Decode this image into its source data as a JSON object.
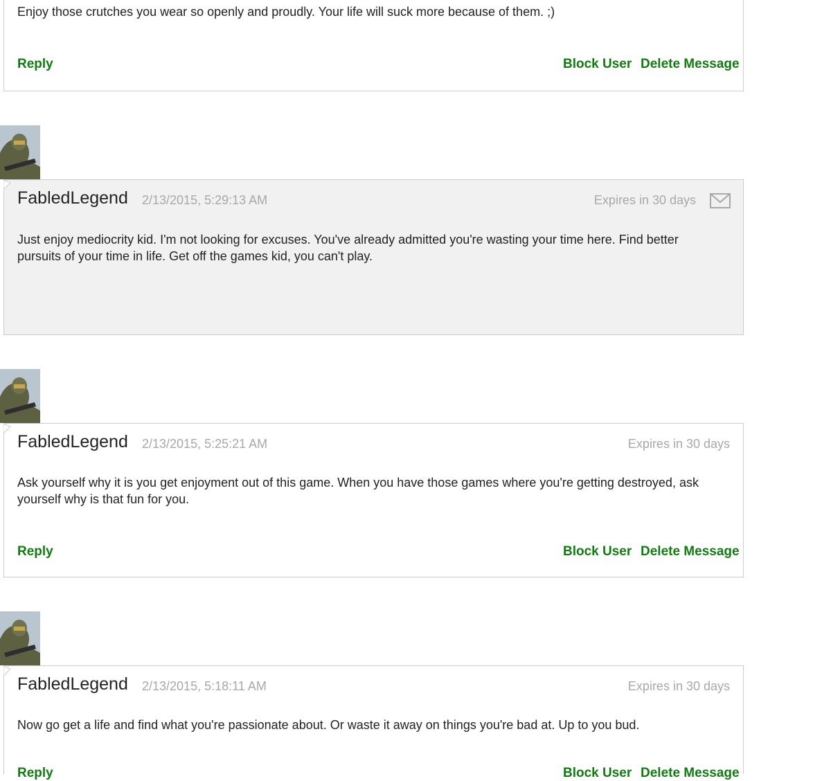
{
  "colors": {
    "accent_green": "#107c10",
    "meta_gray": "#a8a8a8",
    "card_border": "#cccccc",
    "unread_bg": "#f1f1f1"
  },
  "messages": [
    {
      "body": "Enjoy those crutches you wear so openly and proudly. Your life will suck more because of them. ;)",
      "reply": "Reply",
      "block": "Block User",
      "delete": "Delete Message"
    },
    {
      "sender": "FabledLegend",
      "timestamp": "2/13/2015, 5:29:13 AM",
      "expires": "Expires in 30 days",
      "icon": "mail-icon",
      "body": "Just enjoy mediocrity kid. I'm not looking for excuses. You've already admitted you're wasting your time here. Find better pursuits of your time in life. Get off the games kid, you can't play."
    },
    {
      "sender": "FabledLegend",
      "timestamp": "2/13/2015, 5:25:21 AM",
      "expires": "Expires in 30 days",
      "body": "Ask yourself why it is you get enjoyment out of this game. When you have those games where you're getting destroyed, ask yourself why is that fun for you.",
      "reply": "Reply",
      "block": "Block User",
      "delete": "Delete Message"
    },
    {
      "sender": "FabledLegend",
      "timestamp": "2/13/2015, 5:18:11 AM",
      "expires": "Expires in 30 days",
      "body": "Now go get a life and find what you're passionate about. Or waste it away on things you're bad at. Up to you bud.",
      "reply": "Reply",
      "block": "Block User",
      "delete": "Delete Message"
    }
  ]
}
